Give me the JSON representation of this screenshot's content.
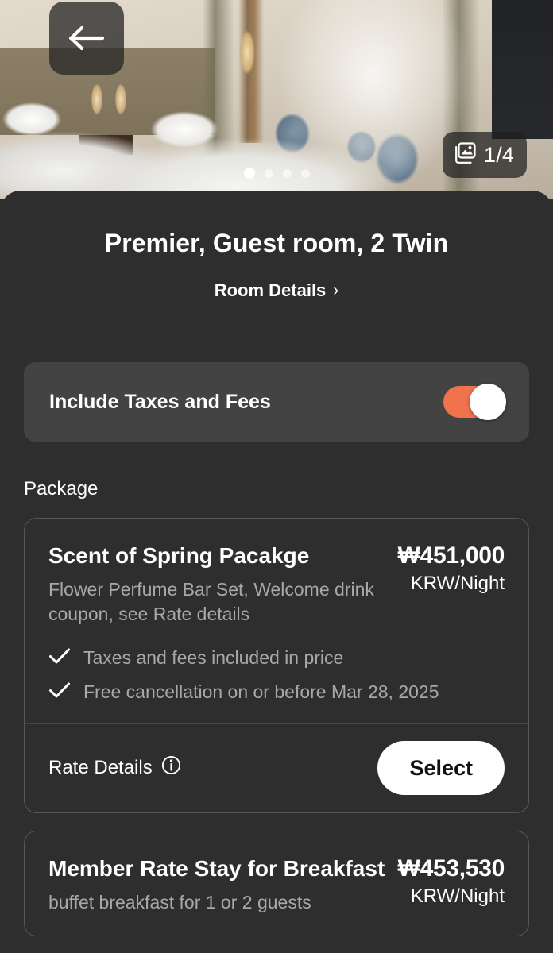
{
  "hero": {
    "back_icon": "arrow-left-icon",
    "photo_badge_icon": "photo-stack-icon",
    "photo_count": "1/4",
    "dots_total": 4,
    "dots_active_index": 0
  },
  "sheet": {
    "room_title": "Premier, Guest room, 2 Twin",
    "room_details_label": "Room Details",
    "room_details_chevron": "›",
    "toggle": {
      "label": "Include Taxes and Fees",
      "state": "on",
      "track_color": "#f0734e",
      "knob_color": "#ffffff"
    },
    "section_label": "Package",
    "rates": [
      {
        "name": "Scent of Spring Pacakge",
        "description": "Flower Perfume Bar Set, Welcome drink coupon, see Rate details",
        "price": "₩451,000",
        "unit": "KRW/Night",
        "perks": [
          "Taxes and fees included in price",
          "Free cancellation on or before Mar 28, 2025"
        ],
        "rate_details_label": "Rate Details",
        "rate_details_icon": "info-icon",
        "select_label": "Select"
      },
      {
        "name": "Member Rate Stay for Breakfast",
        "description": "buffet breakfast for 1 or 2 guests",
        "price": "₩453,530",
        "unit": "KRW/Night"
      }
    ]
  }
}
